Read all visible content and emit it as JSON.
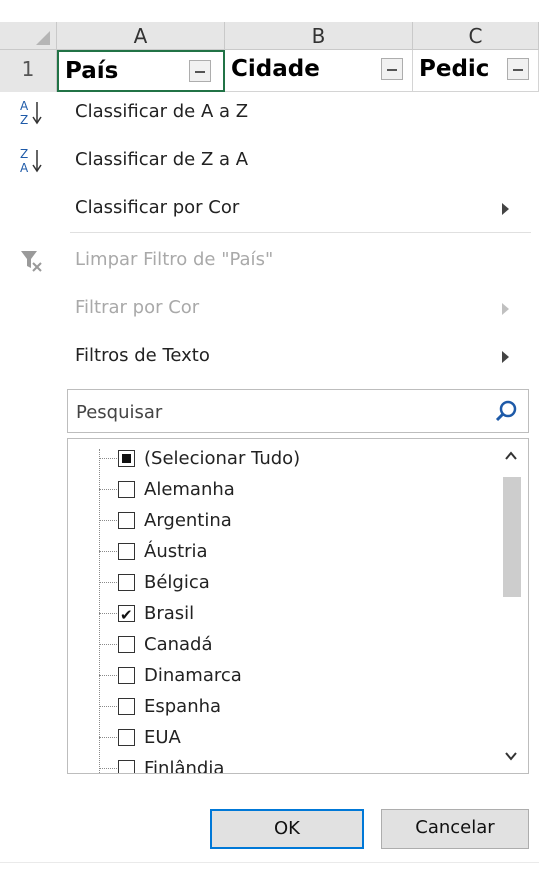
{
  "sheet": {
    "columns": [
      "A",
      "B",
      "C"
    ],
    "row_number": "1",
    "cells": [
      "País",
      "Cidade",
      "Pedic"
    ]
  },
  "menu": {
    "sort_az": "Classificar de A a Z",
    "sort_za": "Classificar de Z a A",
    "sort_color": "Classificar por Cor",
    "clear_filter": "Limpar Filtro de \"País\"",
    "filter_color": "Filtrar por Cor",
    "text_filters": "Filtros de Texto"
  },
  "search": {
    "placeholder": "Pesquisar"
  },
  "list": {
    "items": [
      {
        "label": "(Selecionar Tudo)",
        "state": "indeterminate"
      },
      {
        "label": "Alemanha",
        "state": "unchecked"
      },
      {
        "label": "Argentina",
        "state": "unchecked"
      },
      {
        "label": "Áustria",
        "state": "unchecked"
      },
      {
        "label": "Bélgica",
        "state": "unchecked"
      },
      {
        "label": "Brasil",
        "state": "checked"
      },
      {
        "label": "Canadá",
        "state": "unchecked"
      },
      {
        "label": "Dinamarca",
        "state": "unchecked"
      },
      {
        "label": "Espanha",
        "state": "unchecked"
      },
      {
        "label": "EUA",
        "state": "unchecked"
      },
      {
        "label": "Finlândia",
        "state": "unchecked"
      }
    ]
  },
  "buttons": {
    "ok": "OK",
    "cancel": "Cancelar"
  },
  "colors": {
    "accent": "#217346",
    "focus": "#0078d7",
    "search_icon": "#1e5aa8"
  }
}
